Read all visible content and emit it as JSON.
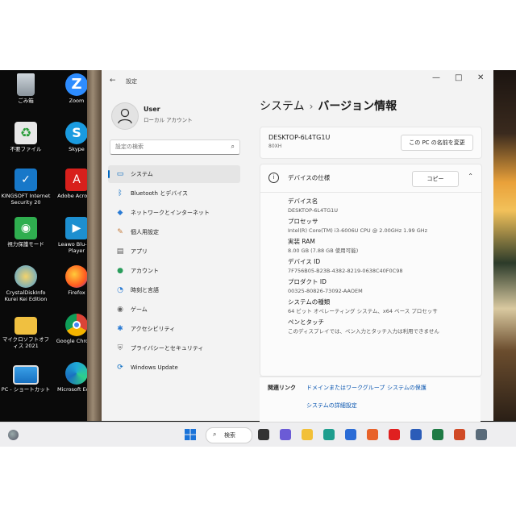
{
  "desktop_icons": [
    {
      "label": "ごみ箱",
      "icon": "recycle-bin-icon"
    },
    {
      "label": "Zoom",
      "icon": "zoom-icon"
    },
    {
      "label": "不要ファイル",
      "icon": "recycle-folder-icon"
    },
    {
      "label": "Skype",
      "icon": "skype-icon"
    },
    {
      "label": "KINGSOFT Internet Security 20",
      "icon": "kingsoft-icon"
    },
    {
      "label": "Adobe Acrobat",
      "icon": "acrobat-icon"
    },
    {
      "label": "視力保護モード",
      "icon": "eye-icon"
    },
    {
      "label": "Leawo Blu-ray Player",
      "icon": "leawo-icon"
    },
    {
      "label": "CrystalDiskInfo Kurei Kei Edition",
      "icon": "crystaldisk-icon"
    },
    {
      "label": "Firefox",
      "icon": "firefox-icon"
    },
    {
      "label": "マイクロソフトオフィス 2021",
      "icon": "folder-icon"
    },
    {
      "label": "Google Chrome",
      "icon": "chrome-icon"
    },
    {
      "label": "PC - ショートカット",
      "icon": "monitor-icon"
    },
    {
      "label": "Microsoft Edge",
      "icon": "edge-icon"
    }
  ],
  "window": {
    "title": "設定",
    "controls": {
      "minimize": "—",
      "maximize": "□",
      "close": "✕"
    }
  },
  "user": {
    "name": "User",
    "account_type": "ローカル アカウント"
  },
  "search": {
    "placeholder": "設定の検索"
  },
  "nav": [
    {
      "label": "システム",
      "icon": "system-icon",
      "glyph": "▭",
      "color": "#0067c0",
      "active": true
    },
    {
      "label": "Bluetooth とデバイス",
      "icon": "bluetooth-icon",
      "glyph": "ᛒ",
      "color": "#0067c0",
      "active": false
    },
    {
      "label": "ネットワークとインターネット",
      "icon": "wifi-icon",
      "glyph": "◆",
      "color": "#2a7bd4",
      "active": false
    },
    {
      "label": "個人用設定",
      "icon": "brush-icon",
      "glyph": "✎",
      "color": "#c47a3a",
      "active": false
    },
    {
      "label": "アプリ",
      "icon": "apps-icon",
      "glyph": "▤",
      "color": "#555555",
      "active": false
    },
    {
      "label": "アカウント",
      "icon": "account-icon",
      "glyph": "●",
      "color": "#2a9d5c",
      "active": false
    },
    {
      "label": "時刻と言語",
      "icon": "clock-globe-icon",
      "glyph": "◔",
      "color": "#2a7bd4",
      "active": false
    },
    {
      "label": "ゲーム",
      "icon": "game-icon",
      "glyph": "◉",
      "color": "#666666",
      "active": false
    },
    {
      "label": "アクセシビリティ",
      "icon": "accessibility-icon",
      "glyph": "✱",
      "color": "#2a7bd4",
      "active": false
    },
    {
      "label": "プライバシーとセキュリティ",
      "icon": "shield-icon",
      "glyph": "⛨",
      "color": "#777777",
      "active": false
    },
    {
      "label": "Windows Update",
      "icon": "windows-update-icon",
      "glyph": "⟳",
      "color": "#0067c0",
      "active": false
    }
  ],
  "header": {
    "breadcrumb_parent": "システム",
    "separator": "›",
    "current": "バージョン情報"
  },
  "device": {
    "name": "DESKTOP-6L4TG1U",
    "model": "80XH",
    "rename_label": "この PC の名前を変更"
  },
  "specs": {
    "title": "デバイスの仕様",
    "copy_label": "コピー",
    "collapse_glyph": "⌃",
    "rows": [
      {
        "label": "デバイス名",
        "value": "DESKTOP-6L4TG1U"
      },
      {
        "label": "プロセッサ",
        "value": "Intel(R) Core(TM) i3-6006U CPU @ 2.00GHz   1.99 GHz"
      },
      {
        "label": "実装 RAM",
        "value": "8.00 GB (7.88 GB 使用可能)"
      },
      {
        "label": "デバイス ID",
        "value": "7F756B05-B23B-4382-8219-0638C40F0C98"
      },
      {
        "label": "プロダクト ID",
        "value": "00325-80826-73092-AAOEM"
      },
      {
        "label": "システムの種類",
        "value": "64 ビット オペレーティング システム、x64 ベース プロセッサ"
      },
      {
        "label": "ペンとタッチ",
        "value": "このディスプレイでは、ペン入力とタッチ入力は利用できません"
      }
    ]
  },
  "related": {
    "label": "関連リンク",
    "links": [
      "ドメインまたはワークグループ",
      "システムの保護",
      "システムの詳細設定"
    ]
  },
  "taskbar": {
    "search_label": "検索",
    "apps": [
      {
        "icon": "taskview-icon",
        "color": "#333333"
      },
      {
        "icon": "chat-icon",
        "color": "#6b5bd6"
      },
      {
        "icon": "explorer-icon",
        "color": "#f2c037"
      },
      {
        "icon": "edge-icon",
        "color": "#1f9e8e"
      },
      {
        "icon": "store-icon",
        "color": "#2b6cd6"
      },
      {
        "icon": "firefox-icon",
        "color": "#e8632b"
      },
      {
        "icon": "youtube-icon",
        "color": "#e02020"
      },
      {
        "icon": "word-icon",
        "color": "#2b5cb8"
      },
      {
        "icon": "excel-icon",
        "color": "#1e7a44"
      },
      {
        "icon": "powerpoint-icon",
        "color": "#d04a26"
      },
      {
        "icon": "settings-icon",
        "color": "#5a6b7a"
      }
    ]
  }
}
